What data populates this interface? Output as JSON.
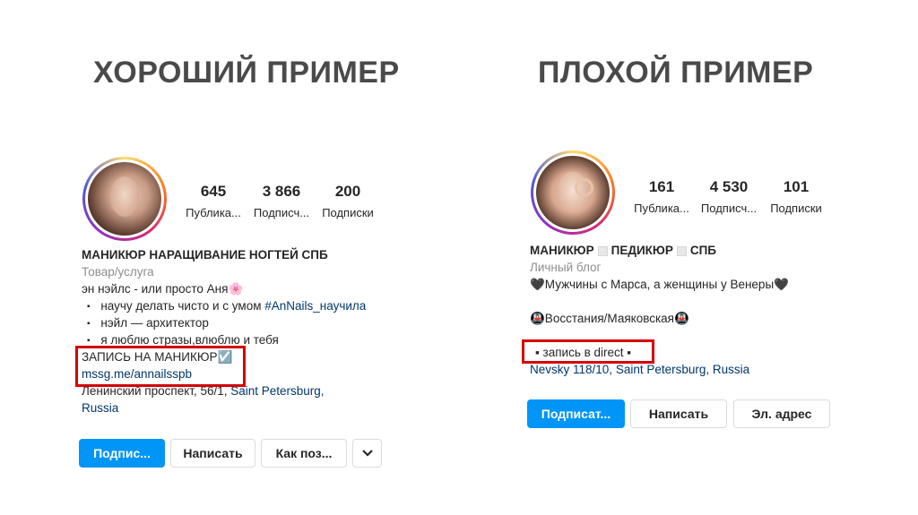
{
  "good": {
    "heading": "ХОРОШИЙ ПРИМЕР",
    "stats": [
      {
        "num": "645",
        "label": "Публика..."
      },
      {
        "num": "3 866",
        "label": "Подписч..."
      },
      {
        "num": "200",
        "label": "Подписки"
      }
    ],
    "name": "МАНИКЮР НАРАЩИВАНИЕ НОГТЕЙ СПБ",
    "category": "Товар/услуга",
    "bio_intro": "эн нэйлс - или просто Аня🌸",
    "bullet1_text": "научу делать чисто и с умом ",
    "bullet1_tag": "#AnNails_научила",
    "bullet2": "нэйл — архитектор",
    "bullet3": "я люблю стразы,влюблю и тебя",
    "cta": "ЗАПИСЬ НА МАНИКЮР",
    "cta_icon": "☑️",
    "link": "mssg.me/annailsspb",
    "address_line1_a": "Ленинский проспект, 56/1, ",
    "address_line1_b": "Saint Petersburg,",
    "address_line2": "Russia",
    "buttons": {
      "subscribe": "Подпис...",
      "message": "Написать",
      "how": "Как поз...",
      "more_icon": "chevron-down-icon"
    }
  },
  "bad": {
    "heading": "ПЛОХОЙ ПРИМЕР",
    "stats": [
      {
        "num": "161",
        "label": "Публика..."
      },
      {
        "num": "4 530",
        "label": "Подписч..."
      },
      {
        "num": "101",
        "label": "Подписки"
      }
    ],
    "name_a": "МАНИКЮР",
    "name_b": "ПЕДИКЮР",
    "name_c": "СПБ",
    "category": "Личный блог",
    "bio_line1": "🖤Мужчины с Марса, а женщины у Венеры🖤",
    "metro": "🚇Восстания/Маяковская🚇",
    "cta": "▪ запись в direct ▪",
    "address_a": "Nevsky  118/10, ",
    "address_b": "Saint Petersburg, Russia",
    "buttons": {
      "subscribe": "Подписат...",
      "message": "Написать",
      "email": "Эл. адрес"
    }
  },
  "colors": {
    "accent": "#0095f6",
    "highlight": "#d40000",
    "link": "#00376b"
  }
}
